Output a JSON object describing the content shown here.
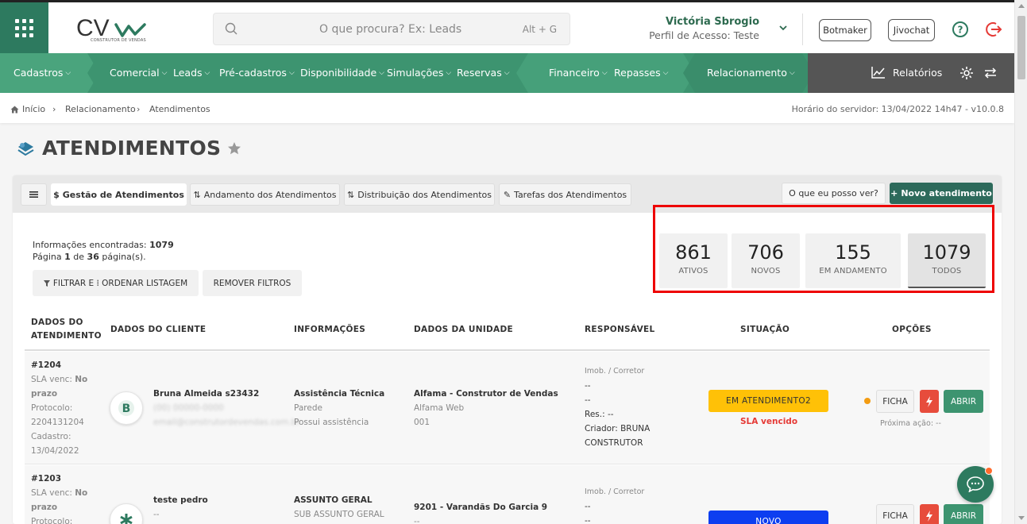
{
  "header": {
    "logo_text": "CV",
    "logo_subtitle": "CONSTRUTOR DE VENDAS",
    "search_placeholder": "O que procura? Ex: Leads",
    "search_shortcut": "Alt + G",
    "user_name": "Victória Sbrogio",
    "user_profile": "Perfil de Acesso: Teste",
    "botmaker_label": "Botmaker",
    "jivochat_label": "Jivochat"
  },
  "nav": {
    "items": [
      {
        "label": "Cadastros"
      },
      {
        "label": "Comercial"
      },
      {
        "label": "Leads"
      },
      {
        "label": "Pré-cadastros"
      },
      {
        "label": "Disponibilidade"
      },
      {
        "label": "Simulações"
      },
      {
        "label": "Reservas"
      },
      {
        "label": "Financeiro"
      },
      {
        "label": "Repasses"
      },
      {
        "label": "Relacionamento"
      }
    ],
    "reports_label": "Relatórios"
  },
  "breadcrumb": {
    "items": [
      "Início",
      "Relacionamento",
      "Atendimentos"
    ],
    "server_time": "Horário do servidor: 13/04/2022 14h47 - v10.0.8"
  },
  "page": {
    "title": "ATENDIMENTOS"
  },
  "tabs": [
    {
      "label": "Gestão de Atendimentos",
      "icon": "$"
    },
    {
      "label": "Andamento dos Atendimentos"
    },
    {
      "label": "Distribuição dos Atendimentos"
    },
    {
      "label": "Tarefas dos Atendimentos"
    }
  ],
  "actions": {
    "what_can_i_see": "O que eu posso ver?",
    "new_label": "Novo atendimento"
  },
  "info": {
    "found_label": "Informações encontradas:",
    "found_count": "1079",
    "page_label": "Página",
    "page_current": "1",
    "page_of": "de",
    "page_total": "36",
    "page_suffix": "página(s)."
  },
  "filters": {
    "filter_label": "FILTRAR E ⁞ ORDENAR LISTAGEM",
    "remove_label": "REMOVER FILTROS"
  },
  "stats": [
    {
      "value": "861",
      "label": "ATIVOS"
    },
    {
      "value": "706",
      "label": "NOVOS"
    },
    {
      "value": "155",
      "label": "EM ANDAMENTO"
    },
    {
      "value": "1079",
      "label": "TODOS"
    }
  ],
  "table": {
    "headers": {
      "dados_atendimento_1": "DADOS DO",
      "dados_atendimento_2": "ATENDIMENTO",
      "cliente": "DADOS DO CLIENTE",
      "informacoes": "INFORMAÇÕES",
      "unidade": "DADOS DA UNIDADE",
      "responsavel": "RESPONSÁVEL",
      "situacao": "SITUAÇÃO",
      "opcoes": "OPÇÕES"
    },
    "rows": [
      {
        "id": "#1204",
        "sla_label": "SLA venc:",
        "sla_value": "No prazo",
        "protocol_label": "Protocolo:",
        "protocol": "2204131204",
        "created_label": "Cadastro:",
        "created": "13/04/2022",
        "client_name": "Bruna Almeida s23432",
        "client_phone": "(00) 00000-0000",
        "client_email": "email@construtordevendas.com.br",
        "info_title": "Assistência Técnica",
        "info_sub1": "Parede",
        "info_sub2": "Possui assistência",
        "unit_title": "Alfama - Construtor de Vendas",
        "unit_sub1": "Alfama Web",
        "unit_sub2": "001",
        "resp_label": "Imob. / Corretor",
        "resp_line1": "--",
        "resp_line2": "--",
        "resp_res": "Res.: --",
        "resp_creator": "Criador: BRUNA CONSTRUTOR",
        "status": "EM ATENDIMENTO2",
        "status_color": "#ffc107",
        "sla_status": "SLA vencido",
        "next_action": "Próxima ação: --",
        "ficha_label": "FICHA",
        "abrir_label": "ABRIR"
      },
      {
        "id": "#1203",
        "sla_label": "SLA venc:",
        "sla_value": "No prazo",
        "protocol_label": "Protocolo:",
        "client_name": "teste pedro",
        "client_line": "--",
        "info_title": "ASSUNTO GERAL",
        "info_sub1": "SUB ASSUNTO GERAL",
        "unit_title": "9201 - Varandãs Do Garcia 9",
        "unit_sub1": "--",
        "resp_label": "Imob. / Corretor",
        "resp_line1": "--",
        "resp_line2": "--",
        "status": "NOVO",
        "status_color": "#0d3ef0",
        "ficha_label": "FICHA",
        "abrir_label": "ABRIR"
      }
    ]
  }
}
